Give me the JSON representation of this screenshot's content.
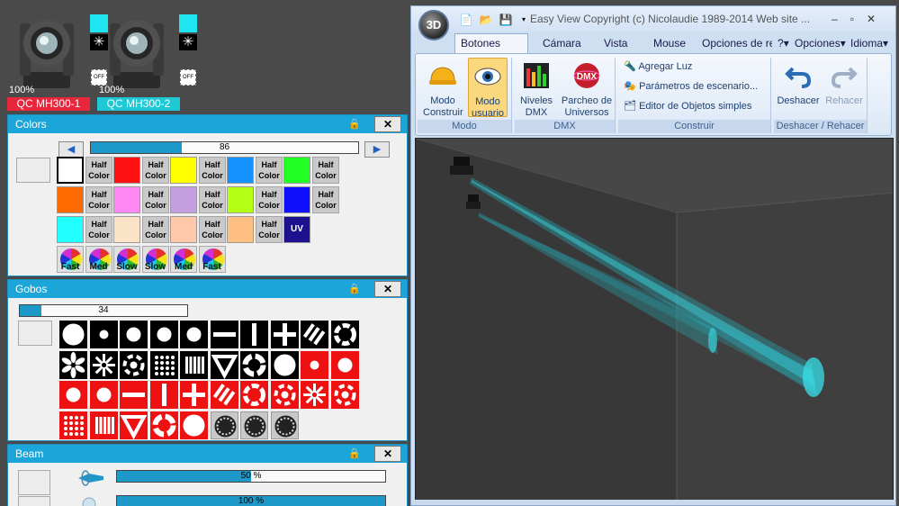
{
  "fixtures": [
    {
      "name": "QC MH300-1",
      "intensity": "100%",
      "name_color": "#e8263c",
      "color_chip": "#1ee6f0",
      "shutter": "OFF"
    },
    {
      "name": "QC MH300-2",
      "intensity": "100%",
      "name_color": "#1ec8d4",
      "color_chip": "#1ee6f0",
      "shutter": "OFF"
    }
  ],
  "colors_panel": {
    "title": "Colors",
    "slider_value": "86",
    "slider_fraction": 0.34,
    "half_label_line1": "Half",
    "half_label_line2": "Color",
    "swatches": [
      [
        "#ffffff",
        "#ff1111",
        "#ffff00",
        "#1493ff",
        "#22ff22"
      ],
      [
        "#ff6a00",
        "#ff88f2",
        "#c49ede",
        "#b4ff14",
        "#1010ff"
      ],
      [
        "#22ffff",
        "#fbe3c8",
        "#ffc8a8",
        "#ffbe82",
        "#fdf3ef"
      ]
    ],
    "uv_label": "UV",
    "uv_color": "#1d1190",
    "wheels": [
      "Fast",
      "Med",
      "Slow",
      "Slow",
      "Med",
      "Fast"
    ]
  },
  "gobos_panel": {
    "title": "Gobos",
    "slider_value": "34",
    "slider_fraction": 0.13
  },
  "beam_panel": {
    "title": "Beam",
    "slider1_value": "50 %",
    "slider1_fraction": 0.5,
    "slider2_value": "100 %",
    "slider2_fraction": 1.0
  },
  "app": {
    "title": "Easy View   Copyright (c) Nicolaudie 1989-2014   Web site ...",
    "orb_label": "3D",
    "tabs": [
      "Botones estánd",
      "Cámara",
      "Vista",
      "Mouse",
      "Opciones de re"
    ],
    "right_menus": [
      "?",
      "Opciones",
      "Idioma"
    ],
    "groups": {
      "modo": {
        "label": "Modo",
        "construir_line1": "Modo",
        "construir_line2": "Construir",
        "usuario_line1": "Modo",
        "usuario_line2": "usuario"
      },
      "dmx": {
        "label": "DMX",
        "niveles_line1": "Niveles",
        "niveles_line2": "DMX",
        "parcheo_line1": "Parcheo de",
        "parcheo_line2": "Universos",
        "dmx_icon_text": "DMX"
      },
      "construir": {
        "label": "Construir",
        "items": [
          "Agregar Luz",
          "Parámetros de escenario...",
          "Editor de Objetos simples"
        ]
      },
      "undo": {
        "label": "Deshacer / Rehacer",
        "deshacer": "Deshacer",
        "rehacer": "Rehacer"
      }
    }
  }
}
